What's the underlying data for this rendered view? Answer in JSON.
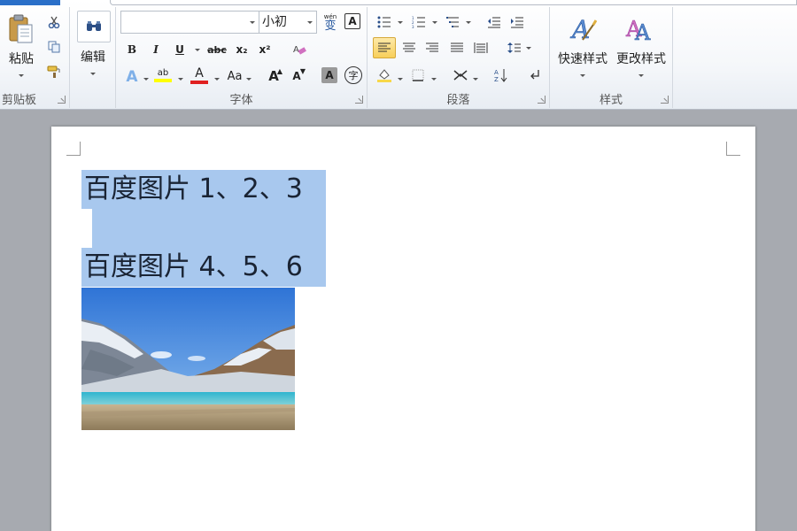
{
  "ribbon": {
    "clipboard": {
      "paste_label": "粘贴",
      "group_label": "剪贴板"
    },
    "editing": {
      "edit_label": "编辑"
    },
    "font": {
      "font_name_value": "",
      "font_size_value": "小初",
      "group_label": "字体",
      "buttons": {
        "bold": "B",
        "italic": "I",
        "underline": "U",
        "strike": "abc",
        "subscript": "x₂",
        "superscript": "x²",
        "text_effect": "A",
        "highlight": "ab",
        "font_color": "A",
        "change_case": "Aa",
        "grow": "A",
        "shrink": "A",
        "char_shading": "A",
        "enclose": "字",
        "phonetic": "wén",
        "border": "A"
      },
      "colors": {
        "highlight": "#ffff00",
        "font_color": "#e02020"
      }
    },
    "paragraph": {
      "group_label": "段落"
    },
    "styles": {
      "quick_styles_label": "快速样式",
      "change_styles_label": "更改样式",
      "group_label": "样式"
    }
  },
  "document": {
    "line1": "百度图片 1、2、3",
    "line2": "百度图片 4、5、6",
    "selection_color": "#a8c8ee"
  }
}
